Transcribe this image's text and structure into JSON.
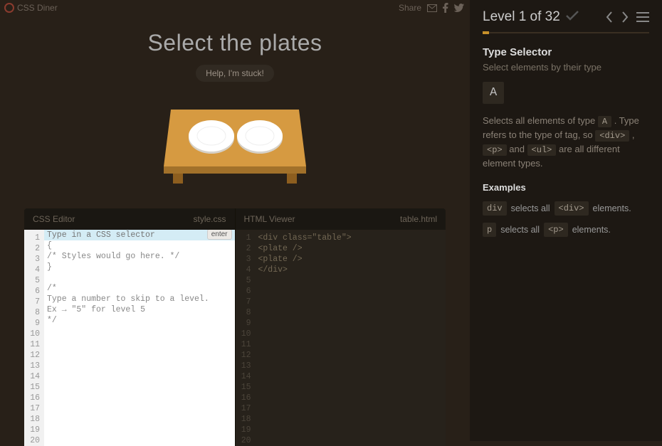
{
  "header": {
    "brand": "CSS Diner",
    "share_label": "Share"
  },
  "title": "Select the plates",
  "help_label": "Help, I'm stuck!",
  "css_editor": {
    "title": "CSS Editor",
    "filename": "style.css",
    "input_placeholder": "Type in a CSS selector",
    "enter_label": "enter",
    "lines": [
      "{",
      "/* Styles would go here. */",
      "}",
      "",
      "/*",
      "Type a number to skip to a level.",
      "Ex → \"5\" for level 5",
      "*/"
    ],
    "line_count": 20
  },
  "html_viewer": {
    "title": "HTML Viewer",
    "filename": "table.html",
    "lines": [
      "<div class=\"table\">",
      "  <plate />",
      "  <plate />",
      "</div>"
    ],
    "line_count": 20
  },
  "sidebar": {
    "level_label": "Level 1 of 32",
    "selector_title": "Type Selector",
    "selector_subtitle": "Select elements by their type",
    "syntax": "A",
    "desc_pre": "Selects all elements of type ",
    "desc_tag1": "A",
    "desc_mid1": " . Type refers to the type of tag, so ",
    "desc_tag2": "<div>",
    "desc_sep1": " , ",
    "desc_tag3": "<p>",
    "desc_sep2": " and ",
    "desc_tag4": "<ul>",
    "desc_post": " are all different element types.",
    "examples_heading": "Examples",
    "examples": [
      {
        "sel": "div",
        "mid": "selects all",
        "tag": "<div>",
        "post": "elements."
      },
      {
        "sel": "p",
        "mid": "selects all",
        "tag": "<p>",
        "post": "elements."
      }
    ]
  }
}
